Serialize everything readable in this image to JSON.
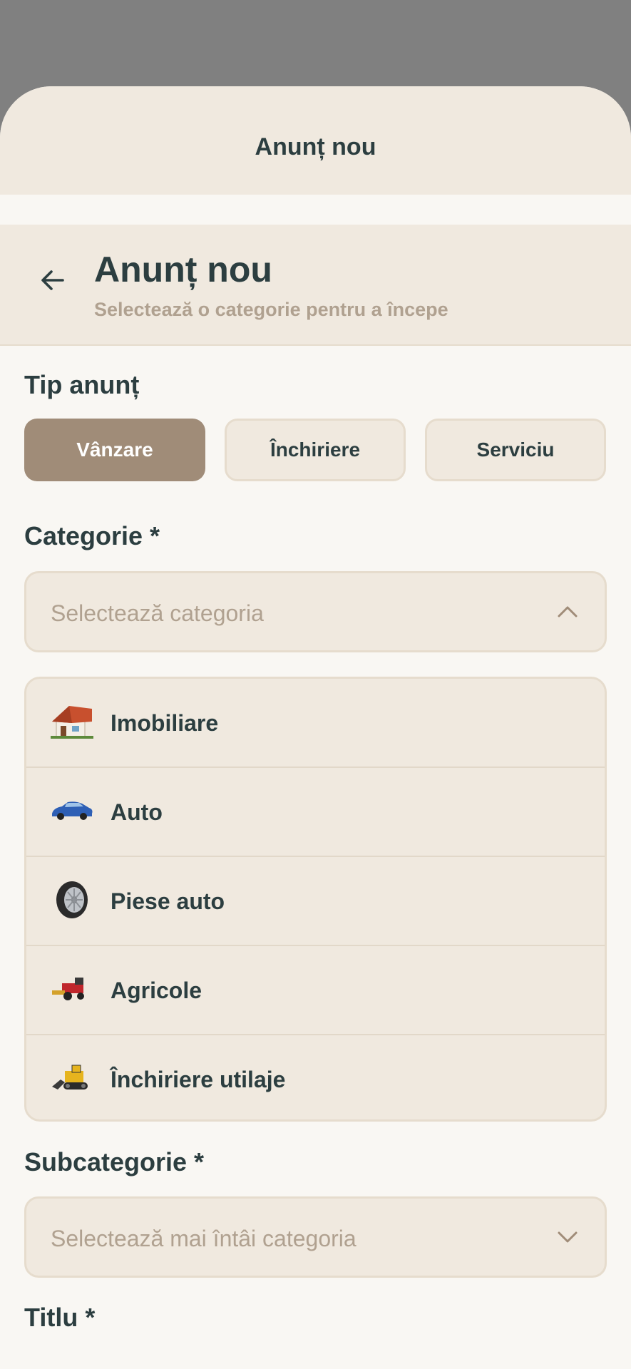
{
  "sheet": {
    "title": "Anunț nou"
  },
  "header": {
    "title": "Anunț nou",
    "subtitle": "Selectează o categorie pentru a începe",
    "back_icon": "arrow-left-icon"
  },
  "listing_type": {
    "label": "Tip anunț",
    "options": [
      {
        "label": "Vânzare",
        "selected": true
      },
      {
        "label": "Închiriere",
        "selected": false
      },
      {
        "label": "Serviciu",
        "selected": false
      }
    ]
  },
  "category": {
    "label": "Categorie *",
    "placeholder": "Selectează categoria",
    "expanded": true,
    "options": [
      {
        "label": "Imobiliare",
        "icon": "house-icon"
      },
      {
        "label": "Auto",
        "icon": "car-icon"
      },
      {
        "label": "Piese auto",
        "icon": "tire-icon"
      },
      {
        "label": "Agricole",
        "icon": "harvester-icon"
      },
      {
        "label": "Închiriere utilaje",
        "icon": "bulldozer-icon"
      }
    ]
  },
  "subcategory": {
    "label": "Subcategorie *",
    "placeholder": "Selectează mai întâi categoria"
  },
  "title_field": {
    "label": "Titlu *"
  },
  "colors": {
    "accent": "#a08c78",
    "text": "#2c3e40",
    "muted": "#b0a190",
    "panel": "#f0e9df",
    "background": "#f9f7f3"
  }
}
